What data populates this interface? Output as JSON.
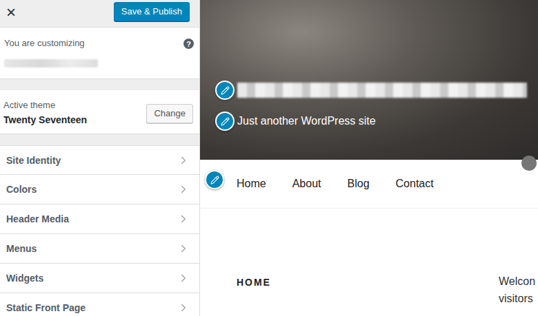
{
  "topbar": {
    "close": "×",
    "publish_button": "Save & Publish"
  },
  "customizing": {
    "label": "You are customizing",
    "help": "?"
  },
  "theme": {
    "label": "Active theme",
    "name": "Twenty Seventeen",
    "change_button": "Change"
  },
  "sections": [
    {
      "label": "Site Identity"
    },
    {
      "label": "Colors"
    },
    {
      "label": "Header Media"
    },
    {
      "label": "Menus"
    },
    {
      "label": "Widgets"
    },
    {
      "label": "Static Front Page"
    }
  ],
  "preview": {
    "tagline": "Just another WordPress site",
    "nav": [
      {
        "label": "Home"
      },
      {
        "label": "About"
      },
      {
        "label": "Blog"
      },
      {
        "label": "Contact"
      }
    ],
    "page_title": "HOME",
    "content_lines": [
      "Welcon",
      "visitors"
    ]
  }
}
